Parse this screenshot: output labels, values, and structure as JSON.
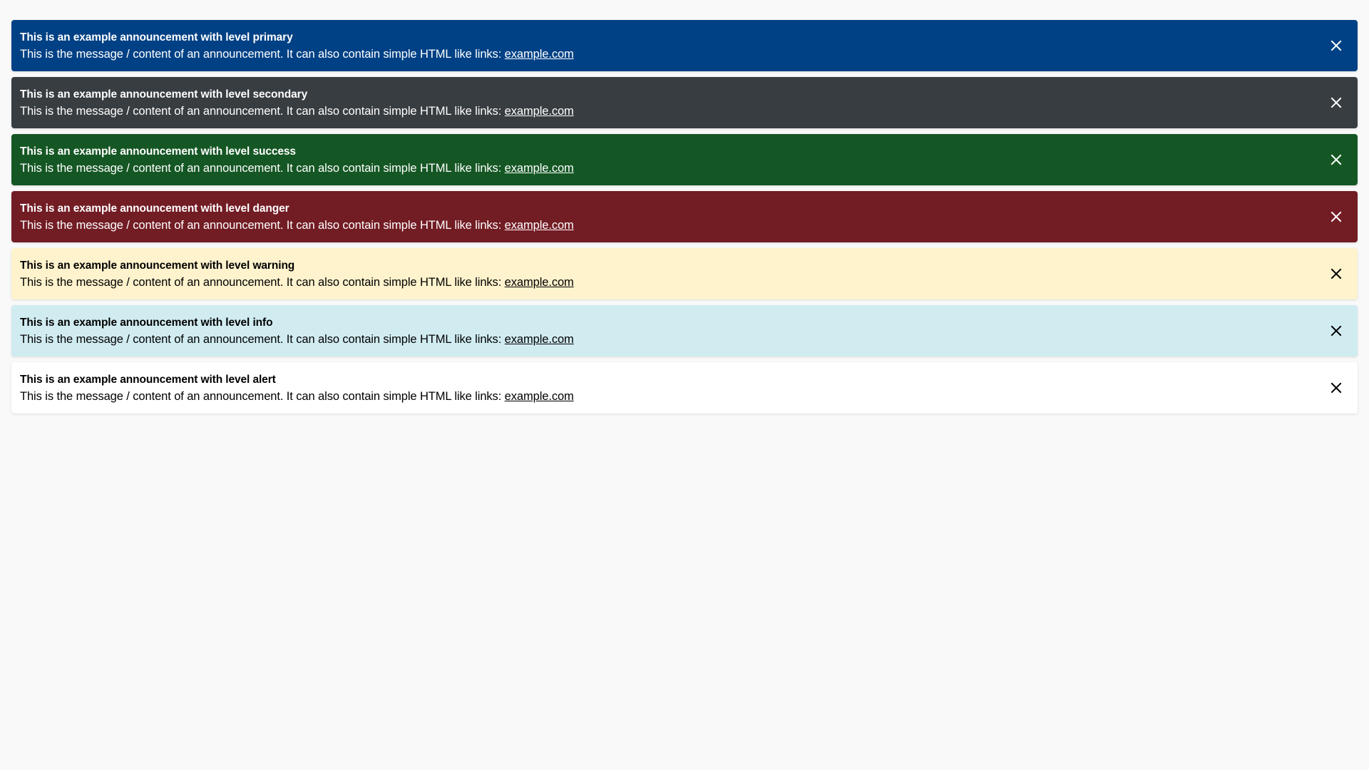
{
  "announcements": [
    {
      "level": "primary",
      "title": "This is an example announcement with level primary",
      "message": "This is the message / content of an announcement. It can also contain simple HTML like links: ",
      "link_text": "example.com",
      "background": "#004185",
      "text_color": "#ffffff",
      "close_icon": "close-icon"
    },
    {
      "level": "secondary",
      "title": "This is an example announcement with level secondary",
      "message": "This is the message / content of an announcement. It can also contain simple HTML like links: ",
      "link_text": "example.com",
      "background": "#383d41",
      "text_color": "#ffffff",
      "close_icon": "close-icon"
    },
    {
      "level": "success",
      "title": "This is an example announcement with level success",
      "message": "This is the message / content of an announcement. It can also contain simple HTML like links: ",
      "link_text": "example.com",
      "background": "#155724",
      "text_color": "#ffffff",
      "close_icon": "close-icon"
    },
    {
      "level": "danger",
      "title": "This is an example announcement with level danger",
      "message": "This is the message / content of an announcement. It can also contain simple HTML like links: ",
      "link_text": "example.com",
      "background": "#721c24",
      "text_color": "#ffffff",
      "close_icon": "close-icon"
    },
    {
      "level": "warning",
      "title": "This is an example announcement with level warning",
      "message": "This is the message / content of an announcement. It can also contain simple HTML like links: ",
      "link_text": "example.com",
      "background": "#fff3cd",
      "text_color": "#000000",
      "close_icon": "close-icon"
    },
    {
      "level": "info",
      "title": "This is an example announcement with level info",
      "message": "This is the message / content of an announcement. It can also contain simple HTML like links: ",
      "link_text": "example.com",
      "background": "#d1ecf1",
      "text_color": "#000000",
      "close_icon": "close-icon"
    },
    {
      "level": "alert",
      "title": "This is an example announcement with level alert",
      "message": "This is the message / content of an announcement. It can also contain simple HTML like links: ",
      "link_text": "example.com",
      "background": "#ffffff",
      "text_color": "#000000",
      "close_icon": "close-icon"
    }
  ],
  "page_background": "#f9f9f9"
}
